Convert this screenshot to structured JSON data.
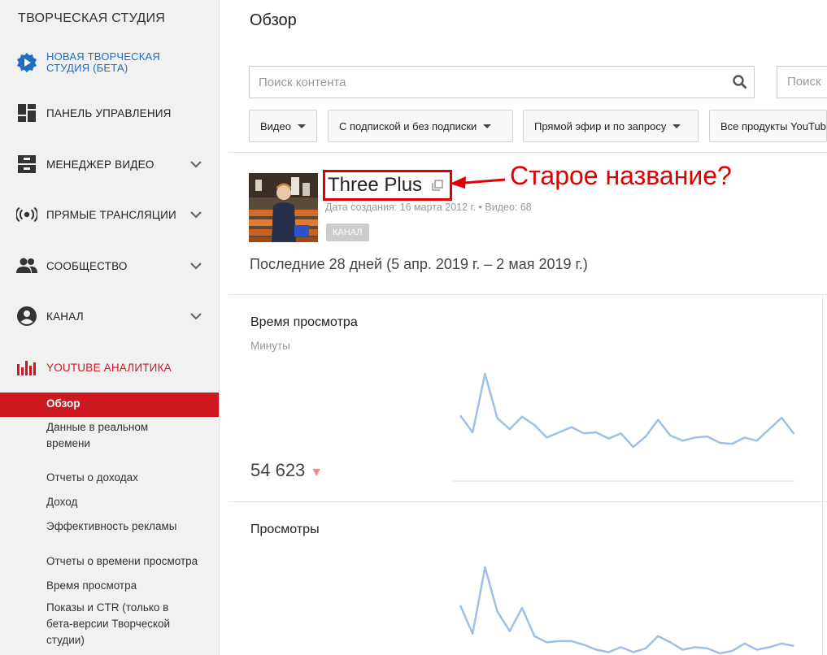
{
  "sidebar": {
    "studio_title": "ТВОРЧЕСКАЯ СТУДИЯ",
    "new_studio": "НОВАЯ ТВОРЧЕСКАЯ СТУДИЯ (БЕТА)",
    "items": [
      {
        "label": "ПАНЕЛЬ УПРАВЛЕНИЯ",
        "icon": "dashboard-icon"
      },
      {
        "label": "МЕНЕДЖЕР ВИДЕО",
        "icon": "video-manager-icon"
      },
      {
        "label": "ПРЯМЫЕ ТРАНСЛЯЦИИ",
        "icon": "live-icon"
      },
      {
        "label": "СООБЩЕСТВО",
        "icon": "community-icon"
      },
      {
        "label": "КАНАЛ",
        "icon": "channel-icon"
      },
      {
        "label": "YOUTUBE АНАЛИТИКА",
        "icon": "analytics-icon"
      }
    ],
    "analytics_sub": {
      "overview": "Обзор",
      "realtime": "Данные в реальном времени",
      "revenue_reports": "Отчеты о доходах",
      "revenue": "Доход",
      "ad_performance": "Эффективность рекламы",
      "watch_time_reports": "Отчеты о времени просмотра",
      "watch_time": "Время просмотра",
      "impressions_ctr": "Показы и CTR (только в бета-версии Творческой студии)"
    }
  },
  "main": {
    "title": "Обзор",
    "search_placeholder": "Поиск контента",
    "search2_placeholder": "Поиск",
    "filters": [
      "Видео",
      "С подпиской и без подписки",
      "Прямой эфир и по запросу",
      "Все продукты YouTube"
    ],
    "channel": {
      "name": "Three Plus",
      "meta": "Дата создания: 16 марта 2012 г.  •  Видео: 68",
      "badge": "КАНАЛ"
    },
    "annotation": "Старое название?",
    "period": "Последние 28 дней (5 апр. 2019 г. – 2 мая 2019 г.)",
    "cards": [
      {
        "title": "Время просмотра",
        "subtitle": "Минуты",
        "value": "54 623",
        "trend": "▼"
      },
      {
        "title": "Просмотры"
      }
    ]
  },
  "colors": {
    "accent_red": "#cc181e",
    "link_blue": "#1c6fc4",
    "annotation_red": "#e00000",
    "spark": "#9fc0e6"
  },
  "chart_data": [
    {
      "type": "line",
      "title": "Время просмотра",
      "ylabel": "Минуты",
      "values": [
        60,
        28,
        140,
        55,
        34,
        58,
        42,
        18,
        28,
        38,
        26,
        28,
        16,
        26,
        0,
        20,
        52,
        22,
        12,
        18,
        20,
        8,
        6,
        18,
        12,
        34,
        56,
        25
      ]
    },
    {
      "type": "line",
      "title": "Просмотры",
      "values": [
        78,
        32,
        140,
        68,
        36,
        74,
        28,
        18,
        20,
        20,
        14,
        6,
        2,
        10,
        2,
        8,
        28,
        18,
        6,
        10,
        8,
        0,
        4,
        16,
        6,
        10,
        16,
        12
      ]
    }
  ]
}
